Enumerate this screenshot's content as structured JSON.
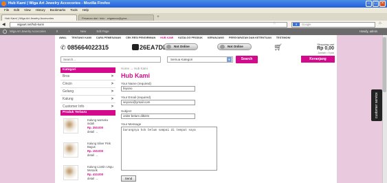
{
  "window": {
    "title": "Hub Kami | Wiga Art Jewelry Accecories - Mozilla Firefox"
  },
  "menu": [
    "File",
    "Edit",
    "View",
    "History",
    "Bookmarks",
    "Tools",
    "Help"
  ],
  "tabs": [
    {
      "label": "Hub Kami | Wiga Art Jewelry Accecories"
    },
    {
      "label": "Pesanan dari: toko - wigaaccs@gma..."
    }
  ],
  "address": {
    "url": "wigaart.net/hub-kami",
    "search_placeholder": "Google"
  },
  "toolbar": {
    "items": [
      "Wiga Art Jewelry Accecories",
      "0",
      "+",
      "New",
      "Edit Page"
    ],
    "greeting": "Howdy, admin"
  },
  "nav": [
    "AWAL",
    "TENTANG KAMI",
    "CARA PEMESANAN",
    "CEK RESI PENGIRIMAN",
    "HUB KAMI",
    "KATALOG PRODUK",
    "KERANJANG",
    "PERSYARATAN DAN KETENTUAN",
    "TESTIMONI"
  ],
  "nav_active": "HUB KAMI",
  "contact": {
    "phone": "085664022315",
    "bbm": "26EA7DBC",
    "ym1": "Not Online",
    "ym2": "Not Online"
  },
  "cart": {
    "label": "Shopping cart",
    "amount": "Rp 0,00",
    "items": "Jumlah = 0 pcs",
    "button": "Keranjang"
  },
  "search": {
    "placeholder": "Search...",
    "category": "Semua Kategori",
    "button": "Search"
  },
  "sidebar": {
    "title": "Kategori",
    "items": [
      "Bros",
      "Cincin",
      "Gelang",
      "Kalung",
      "Customer Info"
    ],
    "products_title": "Produk Terbaru",
    "products": [
      {
        "name": "Kalung warnaku indah",
        "price": "Rp. 350.000",
        "detail": "detail →"
      },
      {
        "name": "Kalung Silver Pink Bagus",
        "price": "Rp. 150.000",
        "detail": "detail →"
      },
      {
        "name": "Kalung Liontin Ungu Menarik",
        "price": "Rp. 410.000",
        "detail": "detail →"
      }
    ]
  },
  "content": {
    "breadcrumb": "Home → Hub Kami",
    "title": "Hub Kami",
    "name_label": "Your Name (required)",
    "name_value": "feyono",
    "email_label": "Your Email (required)",
    "email_value": "seyono@ymail.com",
    "subject_label": "Subject",
    "subject_value": "order belum dikirim",
    "message_label": "Your Message",
    "message_value": "barangnya kok belum sampai di tempat saya",
    "send_label": "Send"
  },
  "side_tab": "customer service"
}
